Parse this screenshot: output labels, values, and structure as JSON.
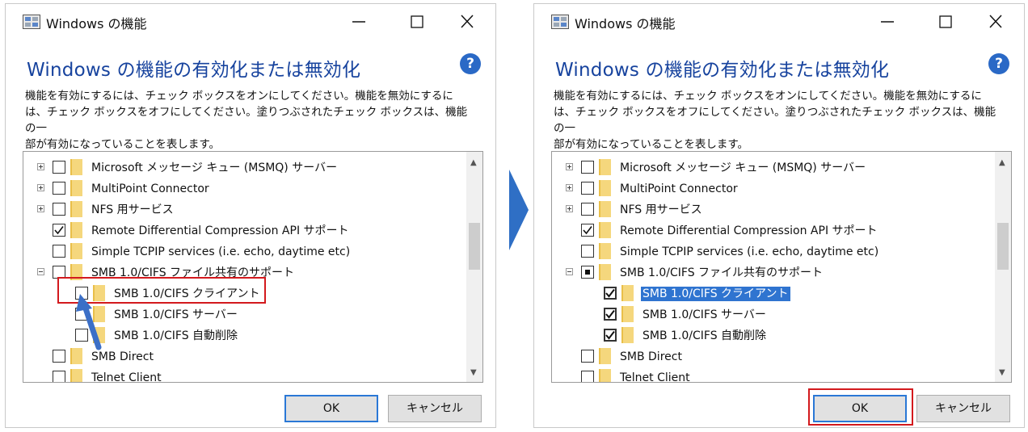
{
  "dialogs": [
    {
      "title": "Windows の機能",
      "heading": "Windows の機能の有効化または無効化",
      "help_icon_text": "?",
      "description_lines": [
        "機能を有効にするには、チェック ボックスをオンにしてください。機能を無効にするに",
        "は、チェック ボックスをオフにしてください。塗りつぶされたチェック ボックスは、機能の一",
        "部が有効になっていることを表します。"
      ],
      "features": [
        {
          "label": "Microsoft メッセージ キュー (MSMQ) サーバー",
          "state": "unchecked",
          "expander": "plus",
          "level": 0
        },
        {
          "label": "MultiPoint Connector",
          "state": "unchecked",
          "expander": "plus",
          "level": 0
        },
        {
          "label": "NFS 用サービス",
          "state": "unchecked",
          "expander": "plus",
          "level": 0
        },
        {
          "label": "Remote Differential Compression API サポート",
          "state": "checked",
          "expander": "none",
          "level": 0
        },
        {
          "label": "Simple TCPIP services (i.e. echo, daytime etc)",
          "state": "unchecked",
          "expander": "none",
          "level": 0
        },
        {
          "label": "SMB 1.0/CIFS ファイル共有のサポート",
          "state": "unchecked",
          "expander": "minus",
          "level": 0
        },
        {
          "label": "SMB 1.0/CIFS クライアント",
          "state": "unchecked",
          "expander": "none",
          "level": 1
        },
        {
          "label": "SMB 1.0/CIFS サーバー",
          "state": "unchecked",
          "expander": "none",
          "level": 1
        },
        {
          "label": "SMB 1.0/CIFS 自動削除",
          "state": "unchecked",
          "expander": "none",
          "level": 1
        },
        {
          "label": "SMB Direct",
          "state": "unchecked",
          "expander": "none",
          "level": 0
        },
        {
          "label": "Telnet Client",
          "state": "unchecked",
          "expander": "none",
          "level": 0
        }
      ],
      "ok_label": "OK",
      "cancel_label": "キャンセル"
    },
    {
      "title": "Windows の機能",
      "heading": "Windows の機能の有効化または無効化",
      "help_icon_text": "?",
      "description_lines": [
        "機能を有効にするには、チェック ボックスをオンにしてください。機能を無効にするに",
        "は、チェック ボックスをオフにしてください。塗りつぶされたチェック ボックスは、機能の一",
        "部が有効になっていることを表します。"
      ],
      "features": [
        {
          "label": "Microsoft メッセージ キュー (MSMQ) サーバー",
          "state": "unchecked",
          "expander": "plus",
          "level": 0
        },
        {
          "label": "MultiPoint Connector",
          "state": "unchecked",
          "expander": "plus",
          "level": 0
        },
        {
          "label": "NFS 用サービス",
          "state": "unchecked",
          "expander": "plus",
          "level": 0
        },
        {
          "label": "Remote Differential Compression API サポート",
          "state": "checked",
          "expander": "none",
          "level": 0
        },
        {
          "label": "Simple TCPIP services (i.e. echo, daytime etc)",
          "state": "unchecked",
          "expander": "none",
          "level": 0
        },
        {
          "label": "SMB 1.0/CIFS ファイル共有のサポート",
          "state": "partial",
          "expander": "minus",
          "level": 0
        },
        {
          "label": "SMB 1.0/CIFS クライアント",
          "state": "checked-bold",
          "expander": "none",
          "level": 1,
          "selected": true
        },
        {
          "label": "SMB 1.0/CIFS サーバー",
          "state": "checked-bold",
          "expander": "none",
          "level": 1
        },
        {
          "label": "SMB 1.0/CIFS 自動削除",
          "state": "checked-bold",
          "expander": "none",
          "level": 1
        },
        {
          "label": "SMB Direct",
          "state": "unchecked",
          "expander": "none",
          "level": 0
        },
        {
          "label": "Telnet Client",
          "state": "unchecked",
          "expander": "none",
          "level": 0
        }
      ],
      "ok_label": "OK",
      "cancel_label": "キャンセル"
    }
  ],
  "icons": {
    "app": "windows-features-icon",
    "minimize": "minimize-icon",
    "maximize": "maximize-icon",
    "close": "close-icon",
    "help": "help-icon",
    "next_step": "chevron-right-icon",
    "pointer_arrow": "arrow-pointer-icon"
  },
  "colors": {
    "heading": "#17439e",
    "help": "#2a69c6",
    "highlight": "#d3191d",
    "selection": "#2f74d0",
    "step_chevron": "#2f6fc5",
    "folder": "#f5d77d"
  }
}
